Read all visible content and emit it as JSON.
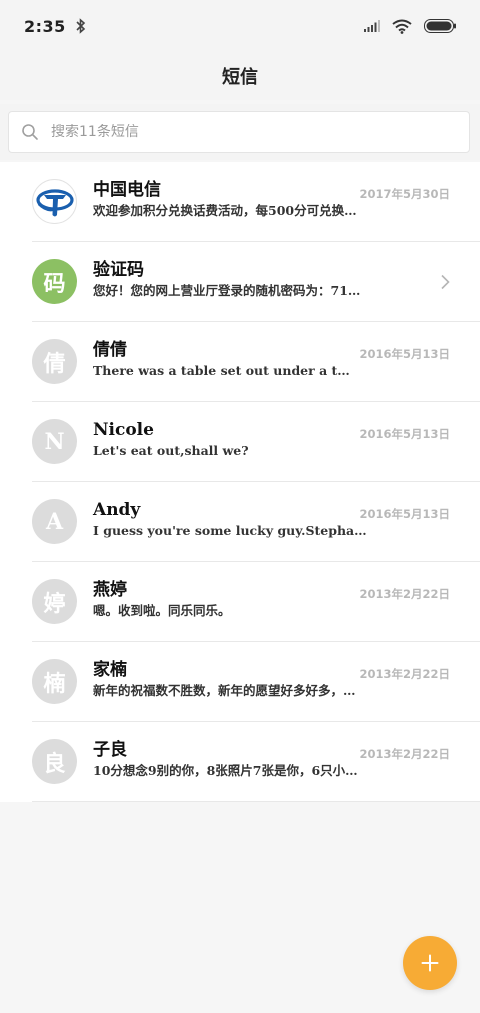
{
  "status_bar": {
    "time": "2:35",
    "icons": [
      "bluetooth-icon",
      "signal-icon",
      "wifi-icon",
      "battery-icon"
    ]
  },
  "header": {
    "title": "短信"
  },
  "search": {
    "placeholder": "搜索11条短信",
    "value": ""
  },
  "conversations": [
    {
      "name": "中国电信",
      "preview": "欢迎参加积分兑换话费活动，每500分可兑换…",
      "date": "2017年5月30日",
      "avatar_text": "",
      "avatar_type": "logo"
    },
    {
      "name": "验证码",
      "preview": "您好！您的网上营业厅登录的随机密码为：71…",
      "date": "",
      "avatar_text": "码",
      "avatar_type": "green",
      "has_chevron": true
    },
    {
      "name": "倩倩",
      "preview": "There was a table set out under a t…",
      "date": "2016年5月13日",
      "avatar_text": "倩",
      "avatar_type": "gray"
    },
    {
      "name": "Nicole",
      "preview": "Let's eat out,shall we?",
      "date": "2016年5月13日",
      "avatar_text": "N",
      "avatar_type": "gray"
    },
    {
      "name": "Andy",
      "preview": "I guess you're some lucky guy.Stepha…",
      "date": "2016年5月13日",
      "avatar_text": "A",
      "avatar_type": "gray"
    },
    {
      "name": "燕婷",
      "preview": "嗯。收到啦。同乐同乐。",
      "date": "2013年2月22日",
      "avatar_text": "婷",
      "avatar_type": "gray"
    },
    {
      "name": "家楠",
      "preview": "新年的祝福数不胜数，新年的愿望好多好多，…",
      "date": "2013年2月22日",
      "avatar_text": "楠",
      "avatar_type": "gray"
    },
    {
      "name": "子良",
      "preview": "10分想念9别的你，8张照片7张是你，6只小…",
      "date": "2013年2月22日",
      "avatar_text": "良",
      "avatar_type": "gray"
    }
  ],
  "fab": {
    "icon": "plus-icon"
  },
  "colors": {
    "accent": "#f7ab35",
    "green_avatar": "#8cc063",
    "gray_avatar": "#dcdcdc",
    "telecom_blue": "#1a5fae"
  }
}
